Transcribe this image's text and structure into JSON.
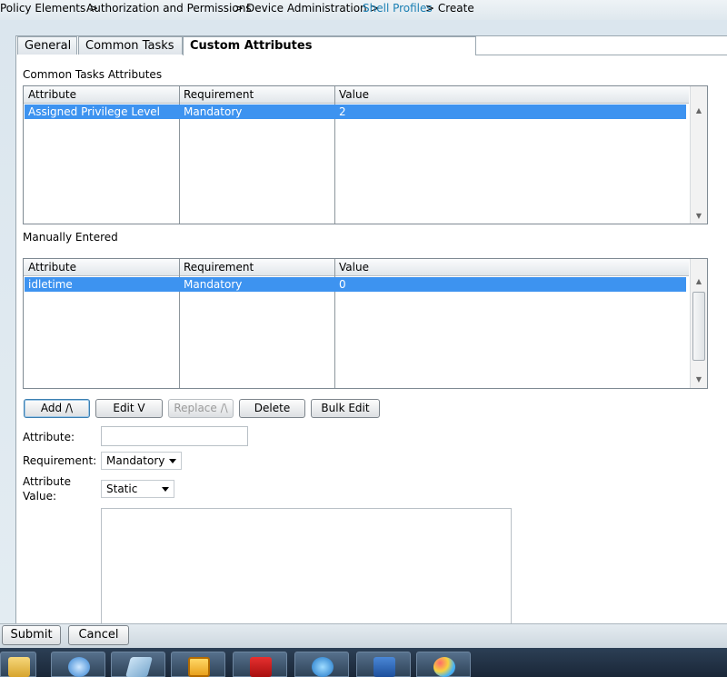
{
  "breadcrumb": {
    "items": [
      "Policy Elements >",
      "Authorization and Permissions",
      ">",
      "Device Administration >",
      "Shell Profiles",
      "> Create"
    ]
  },
  "tabs": [
    "General",
    "Common Tasks",
    "Custom Attributes"
  ],
  "active_tab": "Custom Attributes",
  "common_tasks": {
    "title": "Common Tasks Attributes",
    "columns": [
      "Attribute",
      "Requirement",
      "Value"
    ],
    "rows": [
      {
        "attribute": "Assigned Privilege Level",
        "requirement": "Mandatory",
        "value": "2"
      }
    ]
  },
  "manual": {
    "title": "Manually Entered",
    "columns": [
      "Attribute",
      "Requirement",
      "Value"
    ],
    "rows": [
      {
        "attribute": "idletime",
        "requirement": "Mandatory",
        "value": "0"
      }
    ]
  },
  "buttons": {
    "add": "Add /\\",
    "edit": "Edit V",
    "replace": "Replace /\\",
    "delete": "Delete",
    "bulk_edit": "Bulk Edit"
  },
  "form": {
    "attribute_label": "Attribute:",
    "attribute_value": "",
    "requirement_label": "Requirement:",
    "requirement_selected": "Mandatory",
    "value_label_line1": "Attribute",
    "value_label_line2": "Value:",
    "value_type_selected": "Static"
  },
  "footer": {
    "submit": "Submit",
    "cancel": "Cancel"
  },
  "taskbar": {
    "icons": [
      "folder-icon",
      "network-icon",
      "app-icon",
      "outlook-icon",
      "acrobat-icon",
      "internet-explorer-icon",
      "word-icon",
      "paint-icon"
    ]
  }
}
